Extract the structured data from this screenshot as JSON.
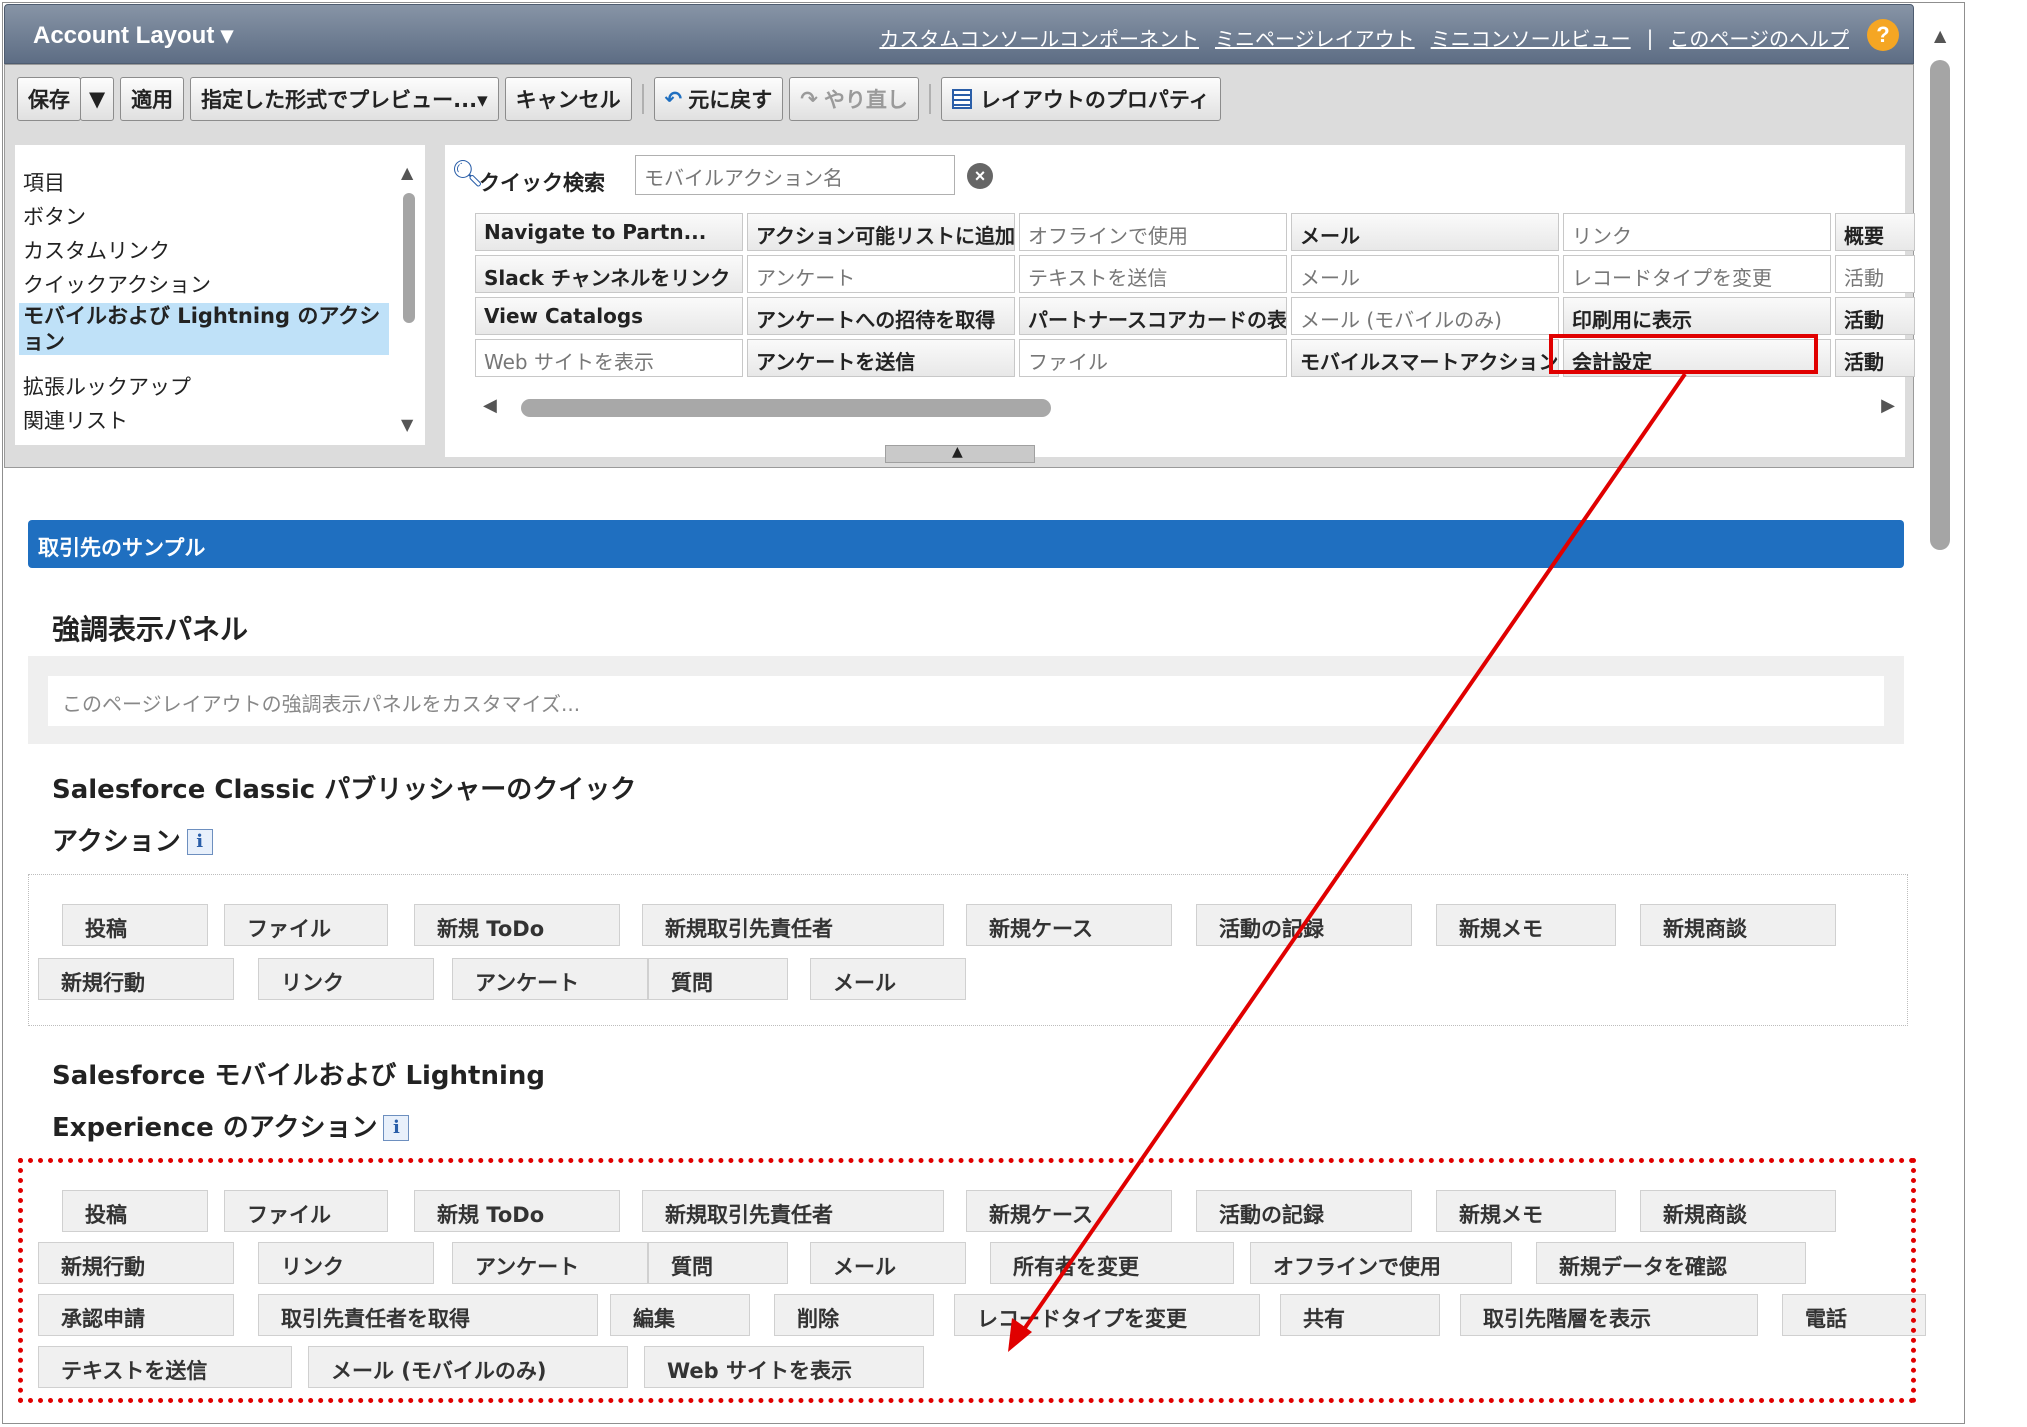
{
  "header": {
    "title": "Account Layout",
    "links": [
      "カスタムコンソールコンポーネント",
      "ミニページレイアウト",
      "ミニコンソールビュー"
    ],
    "separator": "|",
    "help_link": "このページのヘルプ",
    "help_icon": "?"
  },
  "toolbar": {
    "save": "保存",
    "save_menu": "▼",
    "apply": "適用",
    "preview_as": "指定した形式でプレビュー...▾",
    "cancel": "キャンセル",
    "undo": "元に戻す",
    "redo": "やり直し",
    "layout_properties": "レイアウトのプロパティ"
  },
  "palette": {
    "categories": [
      "項目",
      "ボタン",
      "カスタムリンク",
      "クイックアクション",
      "モバイルおよび Lightning のアクション",
      "拡張ルックアップ",
      "関連リスト"
    ],
    "selected_category": "モバイルおよび Lightning のアクション",
    "quick_find_label": "クイック検索",
    "quick_find_placeholder": "モバイルアクション名",
    "grid": [
      [
        {
          "t": "Navigate to Partn...",
          "u": false
        },
        {
          "t": "アクション可能リストに追加",
          "u": false
        },
        {
          "t": "オフラインで使用",
          "u": true
        },
        {
          "t": "メール",
          "u": false
        },
        {
          "t": "リンク",
          "u": true
        },
        {
          "t": "概要",
          "u": false
        }
      ],
      [
        {
          "t": "Slack チャンネルをリンク",
          "u": false
        },
        {
          "t": "アンケート",
          "u": true
        },
        {
          "t": "テキストを送信",
          "u": true
        },
        {
          "t": "メール",
          "u": true
        },
        {
          "t": "レコードタイプを変更",
          "u": true
        },
        {
          "t": "活動",
          "u": true
        }
      ],
      [
        {
          "t": "View Catalogs",
          "u": false
        },
        {
          "t": "アンケートへの招待を取得",
          "u": false
        },
        {
          "t": "パートナースコアカードの表示",
          "u": false
        },
        {
          "t": "メール (モバイルのみ)",
          "u": true
        },
        {
          "t": "印刷用に表示",
          "u": false
        },
        {
          "t": "活動",
          "u": false
        }
      ],
      [
        {
          "t": "Web サイトを表示",
          "u": true
        },
        {
          "t": "アンケートを送信",
          "u": false
        },
        {
          "t": "ファイル",
          "u": true
        },
        {
          "t": "モバイルスマートアクション",
          "u": false
        },
        {
          "t": "会計設定",
          "u": false
        },
        {
          "t": "活動",
          "u": false
        }
      ]
    ]
  },
  "main": {
    "section_title": "取引先のサンプル",
    "highlights_title": "強調表示パネル",
    "highlights_placeholder": "このページレイアウトの強調表示パネルをカスタマイズ...",
    "classic_title_1": "Salesforce Classic パブリッシャーのクイック",
    "classic_title_2": "アクション",
    "info_icon": "i",
    "classic_actions": [
      "投稿",
      "ファイル",
      "新規 ToDo",
      "新規取引先責任者",
      "新規ケース",
      "活動の記録",
      "新規メモ",
      "新規商談",
      "新規行動",
      "リンク",
      "アンケート",
      "質問",
      "メール"
    ],
    "mobile_title_1": "Salesforce モバイルおよび Lightning",
    "mobile_title_2": "Experience のアクション",
    "mobile_actions": [
      "投稿",
      "ファイル",
      "新規 ToDo",
      "新規取引先責任者",
      "新規ケース",
      "活動の記録",
      "新規メモ",
      "新規商談",
      "新規行動",
      "リンク",
      "アンケート",
      "質問",
      "メール",
      "所有者を変更",
      "オフラインで使用",
      "新規データを確認",
      "承認申請",
      "取引先責任者を取得",
      "編集",
      "削除",
      "レコードタイプを変更",
      "共有",
      "取引先階層を表示",
      "電話",
      "テキストを送信",
      "メール (モバイルのみ)",
      "Web サイトを表示"
    ]
  },
  "colors": {
    "annotation": "#e00000",
    "section_bar": "#1f6fc0",
    "header": "#5d6d84"
  },
  "icons": [
    "chevron-down-icon",
    "undo-icon",
    "redo-icon",
    "properties-icon",
    "search-icon",
    "clear-icon",
    "help-icon",
    "info-icon",
    "arrow-icon"
  ]
}
